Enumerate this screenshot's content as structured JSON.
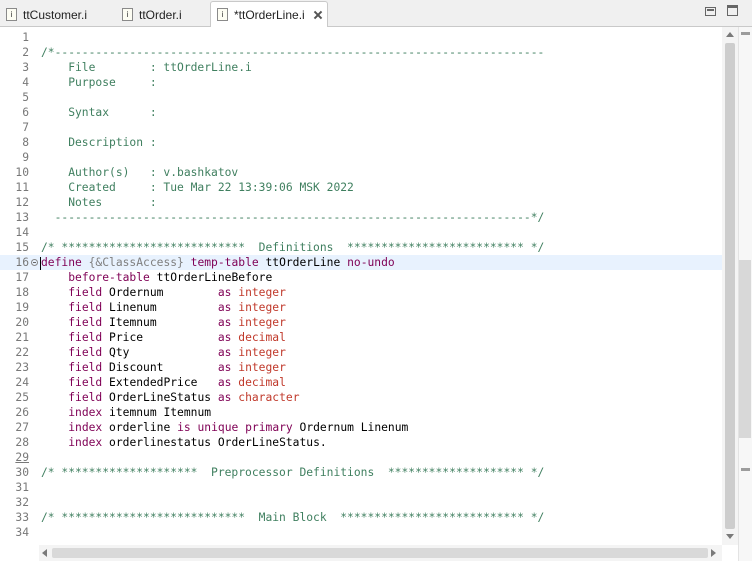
{
  "tabs": [
    {
      "label": "ttCustomer.i",
      "icon": "include-file-icon",
      "active": false
    },
    {
      "label": "ttOrder.i",
      "icon": "include-file-icon",
      "active": false
    },
    {
      "label": "*ttOrderLine.i",
      "icon": "include-file-icon",
      "active": true
    }
  ],
  "tab_icon_glyph": "i",
  "colors": {
    "comment": "#3f7f5f",
    "keyword": "#7f0055",
    "type": "#c0392b",
    "preprocessor": "#7f7f7f",
    "current_line": "#e8f2fe"
  },
  "editor": {
    "current_line": 16,
    "lines": [
      {
        "n": "1",
        "segs": []
      },
      {
        "n": "2",
        "segs": [
          {
            "c": "comment",
            "t": "/*------------------------------------------------------------------------"
          }
        ]
      },
      {
        "n": "3",
        "segs": [
          {
            "c": "comment",
            "t": "    File        : ttOrderLine.i"
          }
        ]
      },
      {
        "n": "4",
        "segs": [
          {
            "c": "comment",
            "t": "    Purpose     :"
          }
        ]
      },
      {
        "n": "5",
        "segs": []
      },
      {
        "n": "6",
        "segs": [
          {
            "c": "comment",
            "t": "    Syntax      :"
          }
        ]
      },
      {
        "n": "7",
        "segs": []
      },
      {
        "n": "8",
        "segs": [
          {
            "c": "comment",
            "t": "    Description :"
          }
        ]
      },
      {
        "n": "9",
        "segs": []
      },
      {
        "n": "10",
        "segs": [
          {
            "c": "comment",
            "t": "    Author(s)   : v.bashkatov"
          }
        ]
      },
      {
        "n": "11",
        "segs": [
          {
            "c": "comment",
            "t": "    Created     : Tue Mar 22 13:39:06 MSK 2022"
          }
        ]
      },
      {
        "n": "12",
        "segs": [
          {
            "c": "comment",
            "t": "    Notes       :"
          }
        ]
      },
      {
        "n": "13",
        "segs": [
          {
            "c": "comment",
            "t": "  ----------------------------------------------------------------------*/"
          }
        ]
      },
      {
        "n": "14",
        "segs": []
      },
      {
        "n": "15",
        "segs": [
          {
            "c": "comment",
            "t": "/* ***************************  Definitions  ************************** */"
          }
        ]
      },
      {
        "n": "16",
        "fold": true,
        "caret": true,
        "segs": [
          {
            "c": "kw",
            "t": "define"
          },
          {
            "c": "plain",
            "t": " "
          },
          {
            "c": "pre",
            "t": "{&ClassAccess}"
          },
          {
            "c": "plain",
            "t": " "
          },
          {
            "c": "kw",
            "t": "temp-table"
          },
          {
            "c": "plain",
            "t": " ttOrderLine "
          },
          {
            "c": "kw",
            "t": "no-undo"
          }
        ]
      },
      {
        "n": "17",
        "segs": [
          {
            "c": "plain",
            "t": "    "
          },
          {
            "c": "kw",
            "t": "before-table"
          },
          {
            "c": "plain",
            "t": " ttOrderLineBefore"
          }
        ]
      },
      {
        "n": "18",
        "segs": [
          {
            "c": "plain",
            "t": "    "
          },
          {
            "c": "kw",
            "t": "field"
          },
          {
            "c": "plain",
            "t": " Ordernum        "
          },
          {
            "c": "kw",
            "t": "as"
          },
          {
            "c": "plain",
            "t": " "
          },
          {
            "c": "type",
            "t": "integer"
          }
        ]
      },
      {
        "n": "19",
        "segs": [
          {
            "c": "plain",
            "t": "    "
          },
          {
            "c": "kw",
            "t": "field"
          },
          {
            "c": "plain",
            "t": " Linenum         "
          },
          {
            "c": "kw",
            "t": "as"
          },
          {
            "c": "plain",
            "t": " "
          },
          {
            "c": "type",
            "t": "integer"
          }
        ]
      },
      {
        "n": "20",
        "segs": [
          {
            "c": "plain",
            "t": "    "
          },
          {
            "c": "kw",
            "t": "field"
          },
          {
            "c": "plain",
            "t": " Itemnum         "
          },
          {
            "c": "kw",
            "t": "as"
          },
          {
            "c": "plain",
            "t": " "
          },
          {
            "c": "type",
            "t": "integer"
          }
        ]
      },
      {
        "n": "21",
        "segs": [
          {
            "c": "plain",
            "t": "    "
          },
          {
            "c": "kw",
            "t": "field"
          },
          {
            "c": "plain",
            "t": " Price           "
          },
          {
            "c": "kw",
            "t": "as"
          },
          {
            "c": "plain",
            "t": " "
          },
          {
            "c": "type",
            "t": "decimal"
          }
        ]
      },
      {
        "n": "22",
        "segs": [
          {
            "c": "plain",
            "t": "    "
          },
          {
            "c": "kw",
            "t": "field"
          },
          {
            "c": "plain",
            "t": " Qty             "
          },
          {
            "c": "kw",
            "t": "as"
          },
          {
            "c": "plain",
            "t": " "
          },
          {
            "c": "type",
            "t": "integer"
          }
        ]
      },
      {
        "n": "23",
        "segs": [
          {
            "c": "plain",
            "t": "    "
          },
          {
            "c": "kw",
            "t": "field"
          },
          {
            "c": "plain",
            "t": " Discount        "
          },
          {
            "c": "kw",
            "t": "as"
          },
          {
            "c": "plain",
            "t": " "
          },
          {
            "c": "type",
            "t": "integer"
          }
        ]
      },
      {
        "n": "24",
        "segs": [
          {
            "c": "plain",
            "t": "    "
          },
          {
            "c": "kw",
            "t": "field"
          },
          {
            "c": "plain",
            "t": " ExtendedPrice   "
          },
          {
            "c": "kw",
            "t": "as"
          },
          {
            "c": "plain",
            "t": " "
          },
          {
            "c": "type",
            "t": "decimal"
          }
        ]
      },
      {
        "n": "25",
        "segs": [
          {
            "c": "plain",
            "t": "    "
          },
          {
            "c": "kw",
            "t": "field"
          },
          {
            "c": "plain",
            "t": " OrderLineStatus "
          },
          {
            "c": "kw",
            "t": "as"
          },
          {
            "c": "plain",
            "t": " "
          },
          {
            "c": "type",
            "t": "character"
          }
        ]
      },
      {
        "n": "26",
        "segs": [
          {
            "c": "plain",
            "t": "    "
          },
          {
            "c": "kw",
            "t": "index"
          },
          {
            "c": "plain",
            "t": " itemnum Itemnum"
          }
        ]
      },
      {
        "n": "27",
        "segs": [
          {
            "c": "plain",
            "t": "    "
          },
          {
            "c": "kw",
            "t": "index"
          },
          {
            "c": "plain",
            "t": " orderline "
          },
          {
            "c": "kw",
            "t": "is"
          },
          {
            "c": "plain",
            "t": " "
          },
          {
            "c": "kw",
            "t": "unique"
          },
          {
            "c": "plain",
            "t": " "
          },
          {
            "c": "kw",
            "t": "primary"
          },
          {
            "c": "plain",
            "t": " Ordernum Linenum"
          }
        ]
      },
      {
        "n": "28",
        "segs": [
          {
            "c": "plain",
            "t": "    "
          },
          {
            "c": "kw",
            "t": "index"
          },
          {
            "c": "plain",
            "t": " orderlinestatus OrderLineStatus."
          }
        ]
      },
      {
        "n": "29",
        "underline": true,
        "segs": []
      },
      {
        "n": "30",
        "segs": [
          {
            "c": "comment",
            "t": "/* ********************  Preprocessor Definitions  ******************** */"
          }
        ]
      },
      {
        "n": "31",
        "segs": []
      },
      {
        "n": "32",
        "segs": []
      },
      {
        "n": "33",
        "segs": [
          {
            "c": "comment",
            "t": "/* ***************************  Main Block  *************************** */"
          }
        ]
      },
      {
        "n": "34",
        "segs": []
      }
    ]
  }
}
